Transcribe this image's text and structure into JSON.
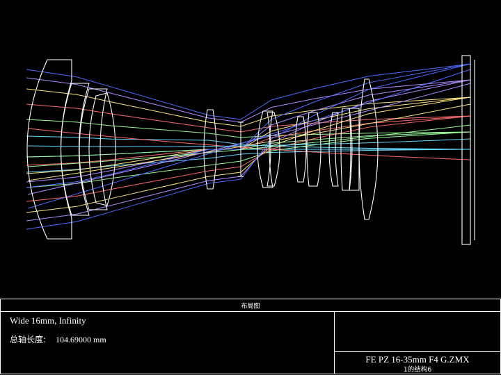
{
  "layout": {
    "header": "布局图",
    "config_name": "Wide 16mm, Infinity",
    "total_length_label": "总轴长度:",
    "total_length_value": "104.69000 mm",
    "filename": "FE PZ 16-35mm F4 G.ZMX",
    "config_index": "1的结构6"
  },
  "colors": {
    "background": "#000000",
    "lens_outline": "#ffffff",
    "rays": [
      "#64d9ff",
      "#98fb98",
      "#ff6b6b",
      "#ffe680",
      "#b08cff",
      "#4d6bff",
      "#ff8cd9"
    ]
  }
}
